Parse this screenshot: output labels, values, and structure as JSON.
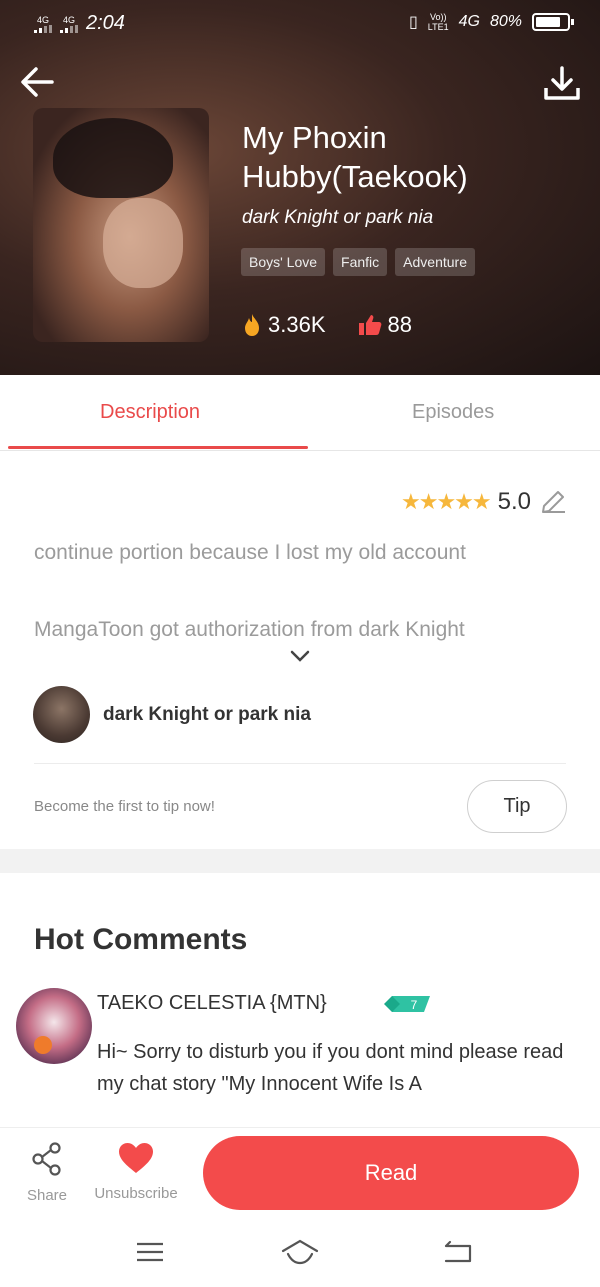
{
  "status_bar": {
    "sim1": "4G",
    "sim2": "4G",
    "time": "2:04",
    "volte": "Vo))",
    "lte": "LTE1",
    "net": "4G",
    "battery": "80%"
  },
  "book": {
    "title": "My Phoxin Hubby(Taekook)",
    "author": "dark Knight or park nia",
    "tags": [
      "Boys' Love",
      "Fanfic",
      "Adventure"
    ],
    "views": "3.36K",
    "likes": "88"
  },
  "tabs": {
    "description": "Description",
    "episodes": "Episodes"
  },
  "description": {
    "rating": "5.0",
    "rating_stars": 5,
    "line1": "continue portion because I lost my old account",
    "line2": "MangaToon got authorization from dark Knight",
    "author_name": "dark Knight or park nia",
    "tip_prompt": "Become the first to tip now!",
    "tip_button": "Tip"
  },
  "comments": {
    "heading": "Hot Comments",
    "items": [
      {
        "user": "TAEKO CELESTIA {MTN}",
        "level": "7",
        "text": "Hi~ Sorry to disturb you if you dont mind please read my chat story \"My Innocent Wife Is A"
      }
    ]
  },
  "bottom_bar": {
    "share": "Share",
    "unsubscribe": "Unsubscribe",
    "read": "Read"
  },
  "colors": {
    "accent": "#e94a4a",
    "read_button": "#f34b4b",
    "star": "#f6b73c",
    "level_badge": "#2fc2a3"
  }
}
